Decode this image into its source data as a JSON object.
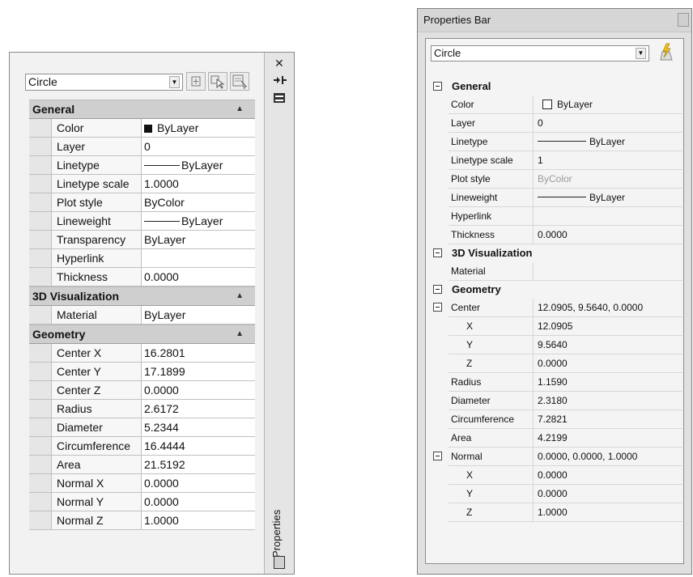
{
  "left_panel": {
    "object_type": "Circle",
    "side_tab_label": "Properties",
    "categories": [
      {
        "name": "General",
        "rows": [
          {
            "label": "Color",
            "value": "ByLayer",
            "swatch": "#111111"
          },
          {
            "label": "Layer",
            "value": "0"
          },
          {
            "label": "Linetype",
            "value": "ByLayer",
            "line": true
          },
          {
            "label": "Linetype scale",
            "value": "1.0000"
          },
          {
            "label": "Plot style",
            "value": "ByColor"
          },
          {
            "label": "Lineweight",
            "value": "ByLayer",
            "line": true
          },
          {
            "label": "Transparency",
            "value": "ByLayer"
          },
          {
            "label": "Hyperlink",
            "value": ""
          },
          {
            "label": "Thickness",
            "value": "0.0000"
          }
        ]
      },
      {
        "name": "3D Visualization",
        "rows": [
          {
            "label": "Material",
            "value": "ByLayer"
          }
        ]
      },
      {
        "name": "Geometry",
        "rows": [
          {
            "label": "Center X",
            "value": "16.2801"
          },
          {
            "label": "Center Y",
            "value": "17.1899"
          },
          {
            "label": "Center Z",
            "value": "0.0000"
          },
          {
            "label": "Radius",
            "value": "2.6172"
          },
          {
            "label": "Diameter",
            "value": "5.2344"
          },
          {
            "label": "Circumference",
            "value": "16.4444"
          },
          {
            "label": "Area",
            "value": "21.5192"
          },
          {
            "label": "Normal X",
            "value": "0.0000"
          },
          {
            "label": "Normal Y",
            "value": "0.0000"
          },
          {
            "label": "Normal Z",
            "value": "1.0000"
          }
        ]
      }
    ]
  },
  "right_panel": {
    "title": "Properties Bar",
    "object_type": "Circle",
    "rows": [
      {
        "kind": "category",
        "label": "General",
        "expand": true
      },
      {
        "kind": "row",
        "label": "Color",
        "value": "ByLayer",
        "swatch": true
      },
      {
        "kind": "row",
        "label": "Layer",
        "value": "0"
      },
      {
        "kind": "row",
        "label": "Linetype",
        "value": "ByLayer",
        "line": true
      },
      {
        "kind": "row",
        "label": "Linetype scale",
        "value": "1"
      },
      {
        "kind": "row",
        "label": "Plot style",
        "value": "ByColor",
        "muted": true
      },
      {
        "kind": "row",
        "label": "Lineweight",
        "value": "ByLayer",
        "line": true
      },
      {
        "kind": "row",
        "label": "Hyperlink",
        "value": ""
      },
      {
        "kind": "row",
        "label": "Thickness",
        "value": "0.0000"
      },
      {
        "kind": "category",
        "label": "3D Visualization",
        "expand": true
      },
      {
        "kind": "row",
        "label": "Material",
        "value": ""
      },
      {
        "kind": "category",
        "label": "Geometry",
        "expand": true
      },
      {
        "kind": "row",
        "label": "Center",
        "value": "12.0905, 9.5640, 0.0000",
        "expand": true
      },
      {
        "kind": "row",
        "label": "X",
        "value": "12.0905",
        "sub": true
      },
      {
        "kind": "row",
        "label": "Y",
        "value": "9.5640",
        "sub": true
      },
      {
        "kind": "row",
        "label": "Z",
        "value": "0.0000",
        "sub": true
      },
      {
        "kind": "row",
        "label": "Radius",
        "value": "1.1590"
      },
      {
        "kind": "row",
        "label": "Diameter",
        "value": "2.3180"
      },
      {
        "kind": "row",
        "label": "Circumference",
        "value": "7.2821"
      },
      {
        "kind": "row",
        "label": "Area",
        "value": "4.2199"
      },
      {
        "kind": "row",
        "label": "Normal",
        "value": "0.0000, 0.0000, 1.0000",
        "expand": true
      },
      {
        "kind": "row",
        "label": "X",
        "value": "0.0000",
        "sub": true
      },
      {
        "kind": "row",
        "label": "Y",
        "value": "0.0000",
        "sub": true
      },
      {
        "kind": "row",
        "label": "Z",
        "value": "1.0000",
        "sub": true
      }
    ]
  },
  "icons": {
    "close": "close-icon",
    "autohide": "autohide-icon",
    "menu": "properties-menu-icon",
    "toggle_pickadd": "toggle-pickadd-icon",
    "select_objects": "select-objects-icon",
    "quick_select": "quick-select-icon",
    "lightning": "quick-select-lightning-icon"
  }
}
